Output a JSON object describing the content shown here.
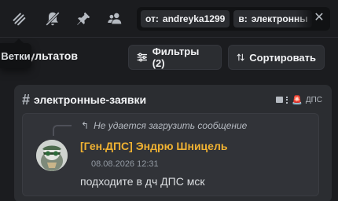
{
  "toolbar": {
    "icons": [
      "threads-icon",
      "mute-notifications-icon",
      "pin-icon",
      "members-icon"
    ]
  },
  "tooltip": {
    "text": "Ветки"
  },
  "search": {
    "chips": [
      {
        "key": "от:",
        "value": "andreyka1299"
      },
      {
        "key": "в:",
        "value": "электронны"
      }
    ],
    "clear_icon": "close-icon"
  },
  "results": {
    "count_text": "зультатов",
    "filters_label": "Фильтры (2)",
    "sort_label": "Сортировать"
  },
  "channel": {
    "prefix": "#",
    "name": "электронные-заявки",
    "category": "ДПС"
  },
  "message": {
    "reply_text": "Не удается загрузить сообщение",
    "author": "[Ген.ДПС] Эндрю Шницель",
    "timestamp": "08.08.2026 12:31",
    "content": "подходите в дч ДПС мск"
  },
  "colors": {
    "background": "#1b1c1f",
    "panel": "#2b2d31",
    "message_bg": "#313338",
    "author": "#f0b232",
    "muted": "#949ba4"
  }
}
